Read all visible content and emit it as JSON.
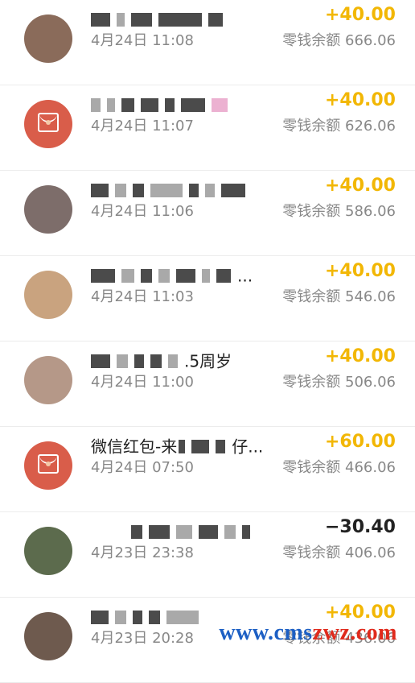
{
  "records": [
    {
      "avatar": "photo",
      "avatar_color": "#8a6b5a",
      "title_tail": "",
      "time": "4月24日 11:08",
      "amount": "+40.00",
      "direction": "in",
      "balance": "零钱余额 666.06"
    },
    {
      "avatar": "envelope",
      "avatar_color": "#d95d4a",
      "title_tail": "",
      "time": "4月24日 11:07",
      "amount": "+40.00",
      "direction": "in",
      "balance": "零钱余额 626.06"
    },
    {
      "avatar": "photo",
      "avatar_color": "#7d6d6a",
      "title_tail": "",
      "time": "4月24日 11:06",
      "amount": "+40.00",
      "direction": "in",
      "balance": "零钱余额 586.06"
    },
    {
      "avatar": "photo",
      "avatar_color": "#c9a37f",
      "title_tail": "...",
      "time": "4月24日 11:03",
      "amount": "+40.00",
      "direction": "in",
      "balance": "零钱余额 546.06"
    },
    {
      "avatar": "photo",
      "avatar_color": "#b59888",
      "title_tail": ".5周岁",
      "time": "4月24日 11:00",
      "amount": "+40.00",
      "direction": "in",
      "balance": "零钱余额 506.06"
    },
    {
      "avatar": "envelope",
      "avatar_color": "#d95d4a",
      "title_head": "微信红包-来",
      "title_tail": "仔...",
      "time": "4月24日 07:50",
      "amount": "+60.00",
      "direction": "in",
      "balance": "零钱余额 466.06"
    },
    {
      "avatar": "photo",
      "avatar_color": "#5c6b4d",
      "title_tail": "",
      "time": "4月23日 23:38",
      "amount": "−30.40",
      "direction": "out",
      "balance": "零钱余额 406.06"
    },
    {
      "avatar": "photo",
      "avatar_color": "#6e5a4e",
      "title_tail": "",
      "time": "4月23日 20:28",
      "amount": "+40.00",
      "direction": "in",
      "balance": "零钱余额 436.06"
    }
  ],
  "watermark": {
    "part_a": "www.cms",
    "part_b": "zwz.com"
  }
}
